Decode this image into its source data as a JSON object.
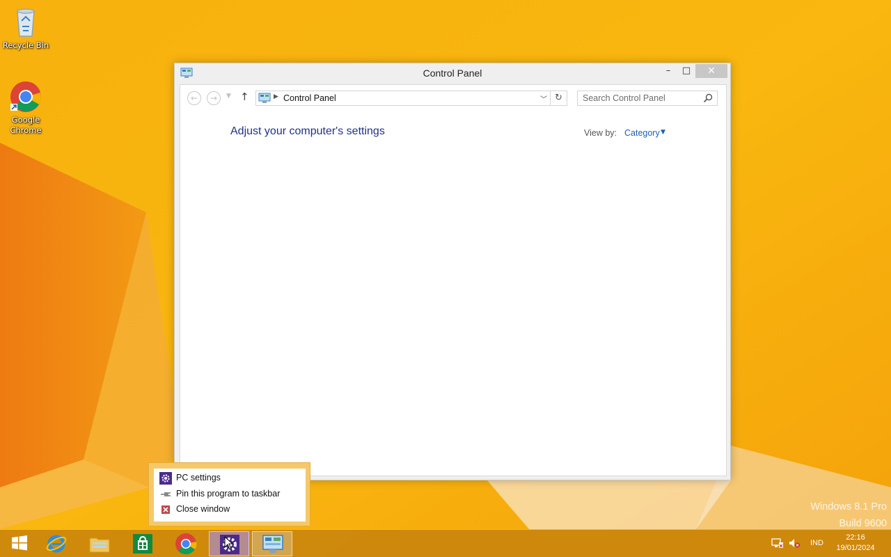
{
  "desktop": {
    "icons": [
      {
        "label": "Recycle Bin",
        "icon": "recycle-bin-icon"
      },
      {
        "label": "Google Chrome",
        "icon": "chrome-icon"
      }
    ],
    "watermark": {
      "line1": "Windows 8.1 Pro",
      "line2": "Build 9600"
    }
  },
  "window": {
    "title": "Control Panel",
    "controls": {
      "minimize": "–",
      "maximize": "□",
      "close": "✕"
    },
    "address": {
      "crumb": "Control Panel"
    },
    "search": {
      "placeholder": "Search Control Panel"
    },
    "heading": "Adjust your computer's settings",
    "view_by": {
      "label": "View by:",
      "value": "Category"
    }
  },
  "jumplist": {
    "items": [
      {
        "label": "PC settings",
        "icon": "pc-settings-gear-icon"
      },
      {
        "label": "Pin this program to taskbar",
        "icon": "pin-icon"
      },
      {
        "label": "Close window",
        "icon": "close-window-icon"
      }
    ]
  },
  "taskbar": {
    "items": [
      "start",
      "internet-explorer",
      "file-explorer",
      "store",
      "chrome",
      "pc-settings",
      "control-panel"
    ],
    "tray": {
      "language": "IND",
      "time": "22:16",
      "date": "19/01/2024"
    }
  },
  "colors": {
    "wallpaper": "#f6a609",
    "heading": "#1e3287",
    "link": "#1a5fb4",
    "pc_settings": "#4b2a8c"
  }
}
